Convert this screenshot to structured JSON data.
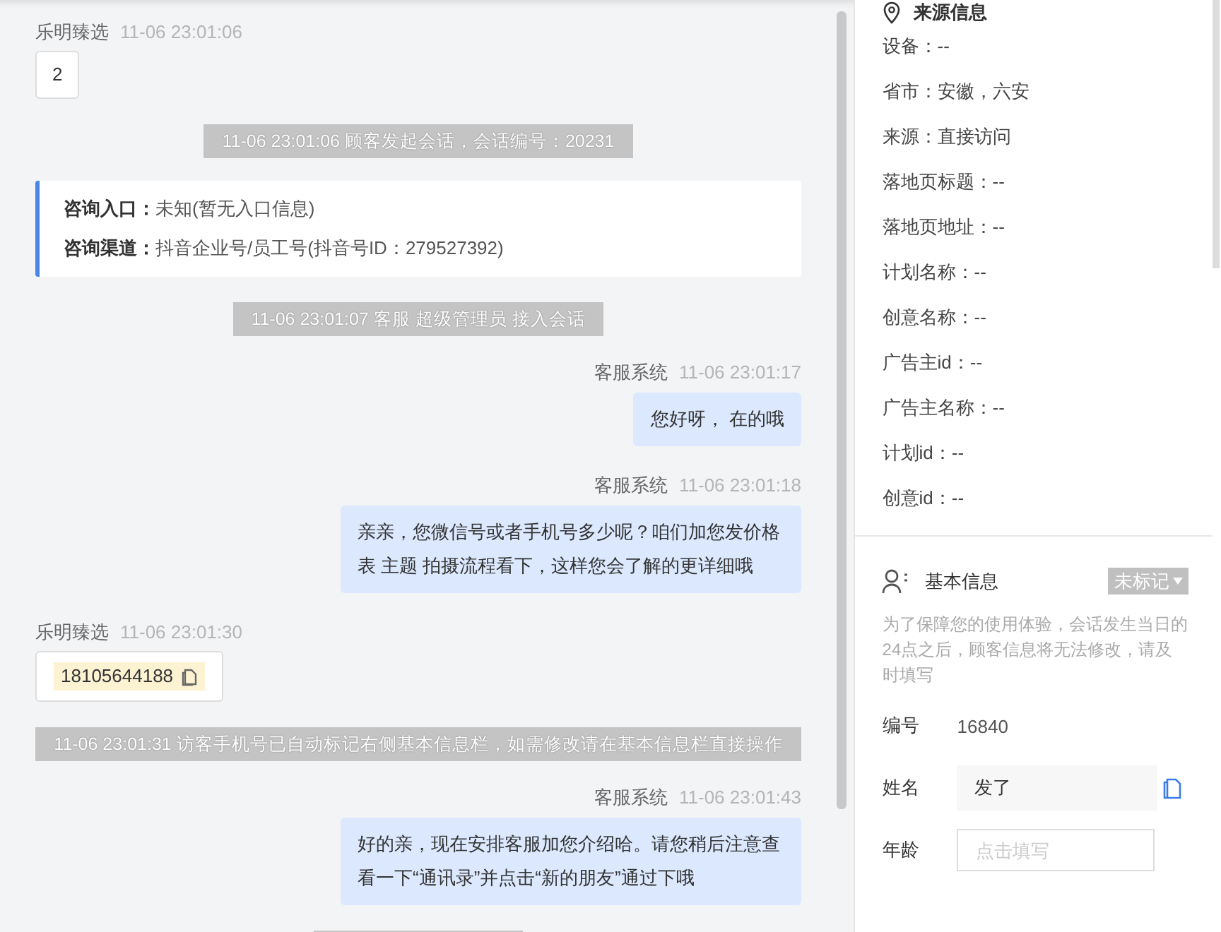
{
  "chat": {
    "messages": [
      {
        "kind": "customer",
        "sender": "乐明臻选",
        "time": "11-06 23:01:06",
        "text": "2"
      },
      {
        "kind": "system",
        "text": "11-06 23:01:06 顾客发起会话，会话编号：20231"
      },
      {
        "kind": "info",
        "entries": [
          {
            "label": "咨询入口：",
            "value": "未知(暂无入口信息)"
          },
          {
            "label": "咨询渠道：",
            "value": "抖音企业号/员工号(抖音号ID：279527392)"
          }
        ]
      },
      {
        "kind": "system",
        "text": "11-06 23:01:07 客服 超级管理员 接入会话"
      },
      {
        "kind": "agent",
        "sender": "客服系统",
        "time": "11-06 23:01:17",
        "text": "您好呀， 在的哦"
      },
      {
        "kind": "agent",
        "sender": "客服系统",
        "time": "11-06 23:01:18",
        "text": "亲亲，您微信号或者手机号多少呢？咱们加您发价格表 主题 拍摄流程看下，这样您会了解的更详细哦"
      },
      {
        "kind": "phone",
        "sender": "乐明臻选",
        "time": "11-06 23:01:30",
        "text": "18105644188"
      },
      {
        "kind": "system",
        "text": "11-06 23:01:31 访客手机号已自动标记右侧基本信息栏，如需修改请在基本信息栏直接操作"
      },
      {
        "kind": "agent",
        "sender": "客服系统",
        "time": "11-06 23:01:43",
        "text": "好的亲，现在安排客服加您介绍哈。请您稍后注意查看一下“通讯录”并点击“新的朋友”通过下哦"
      },
      {
        "kind": "system_hidden"
      }
    ]
  },
  "source_info": {
    "title": "来源信息",
    "rows": [
      "设备：--",
      "省市：安徽，六安",
      "来源：直接访问",
      "落地页标题：--",
      "落地页地址：--",
      "计划名称：--",
      "创意名称：--",
      "广告主id：--",
      "广告主名称：--",
      "计划id：--",
      "创意id：--"
    ]
  },
  "basic_info": {
    "title": "基本信息",
    "tag": "未标记",
    "note": "为了保障您的使用体验，会话发生当日的24点之后，顾客信息将无法修改，请及时填写",
    "fields": [
      {
        "kind": "text",
        "label": "编号",
        "value": "16840"
      },
      {
        "kind": "filled",
        "label": "姓名",
        "value": "发了"
      },
      {
        "kind": "input",
        "label": "年龄",
        "placeholder": "点击填写"
      }
    ]
  }
}
